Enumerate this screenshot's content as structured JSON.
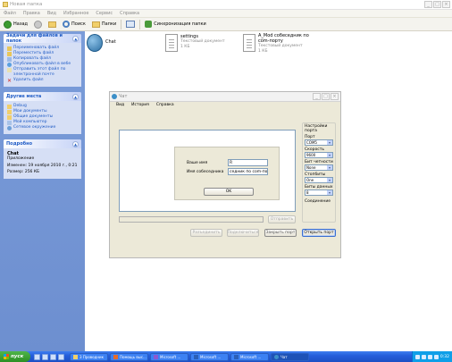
{
  "explorer": {
    "title": "Новая папка",
    "menu": [
      "Файл",
      "Правка",
      "Вид",
      "Избранное",
      "Сервис",
      "Справка"
    ],
    "toolbar": {
      "back": "Назад",
      "search": "Поиск",
      "folders": "Папки",
      "sync": "Синхронизация папки"
    },
    "file_tasks": {
      "title": "Задачи для файлов и папок",
      "items": [
        "Переименовать файл",
        "Переместить файл",
        "Копировать файл",
        "Опубликовать файл в вебе",
        "Отправить этот файл по электронной почте",
        "Удалить файл"
      ]
    },
    "other_places": {
      "title": "Другие места",
      "items": [
        "Debug",
        "Мои документы",
        "Общие документы",
        "Мой компьютер",
        "Сетевое окружение"
      ]
    },
    "details": {
      "title": "Подробно",
      "name": "Chat",
      "type": "Приложение",
      "modified": "Изменен: 19 ноября 2010 г., 0:21",
      "size": "Размер: 256 КБ"
    },
    "files": [
      {
        "name": "Chat",
        "meta1": "",
        "meta2": ""
      },
      {
        "name": "settings",
        "meta1": "Текстовый документ",
        "meta2": "1 КБ"
      },
      {
        "name": "A_Mod собеседник по com-порту",
        "meta1": "Текстовый документ",
        "meta2": "1 КБ"
      }
    ]
  },
  "chat": {
    "title": "Чат",
    "menu": [
      "Вид",
      "История",
      "Справка"
    ],
    "send_label": "Отправить",
    "buttons": {
      "disconnect": "Разъединить",
      "connect": "Подключиться",
      "close_port": "Закрыть порт",
      "open_port": "Открыть порт"
    },
    "port_settings": {
      "title": "Настройки порта",
      "port_label": "Порт",
      "port_value": "COM5",
      "speed_label": "Скорость",
      "speed_value": "9600",
      "parity_label": "Бит четности",
      "parity_value": "None",
      "stopbits_label": "Стопбиты",
      "stopbits_value": "One",
      "databits_label": "Биты данных",
      "databits_value": "8",
      "connection_label": "Соединение"
    }
  },
  "dialog": {
    "your_name_label": "Ваше имя",
    "your_name_value": "R",
    "partner_label": "Имя собеседника",
    "partner_value": "седник по com-порту",
    "ok_label": "OK"
  },
  "taskbar": {
    "start_label": "пуск",
    "tasks": [
      "3 Проводник",
      "Помощь выс...",
      "Microsoft ...",
      "Microsoft ...",
      "Microsoft ...",
      "Чат"
    ],
    "clock": "0:32"
  }
}
